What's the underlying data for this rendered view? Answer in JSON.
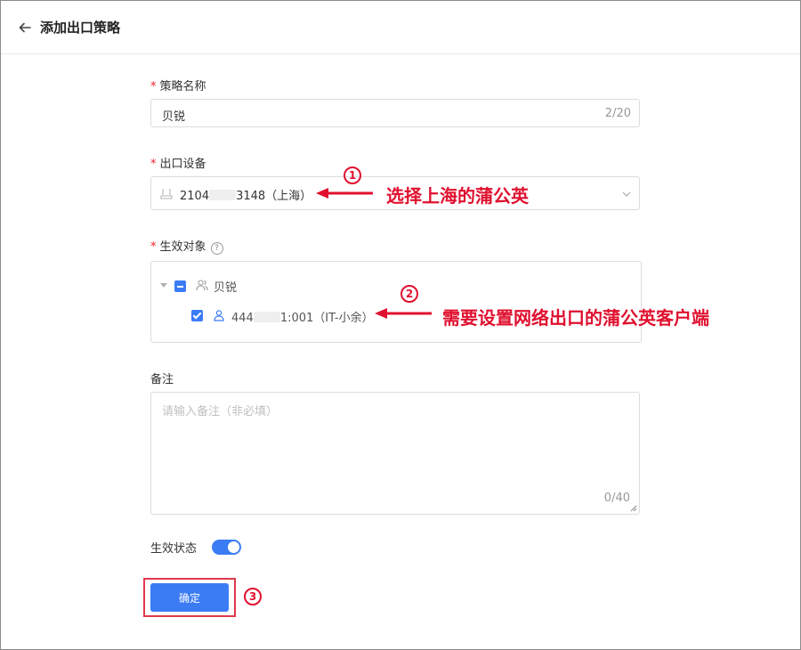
{
  "header": {
    "title": "添加出口策略"
  },
  "form": {
    "policy_name": {
      "label": "策略名称",
      "required_mark": "*",
      "value": "贝锐",
      "counter": "2/20"
    },
    "device": {
      "label": "出口设备",
      "required_mark": "*",
      "value_prefix": "2104",
      "value_suffix": "3148（上海）"
    },
    "targets": {
      "label": "生效对象",
      "required_mark": "*",
      "help": "?",
      "group": {
        "label": "贝锐"
      },
      "member": {
        "prefix": "444",
        "suffix": "1:001（IT-小余）"
      }
    },
    "remark": {
      "label": "备注",
      "placeholder": "请输入备注（非必填）",
      "counter": "0/40"
    },
    "status": {
      "label": "生效状态",
      "enabled": true
    },
    "confirm_label": "确定"
  },
  "annotations": {
    "step1": {
      "number": "1",
      "text": "选择上海的蒲公英"
    },
    "step2": {
      "number": "2",
      "text": "需要设置网络出口的蒲公英客户端"
    },
    "step3": {
      "number": "3"
    }
  },
  "colors": {
    "accent": "#3b7cf5",
    "annotation": "#e0102f",
    "required": "#f5222d"
  }
}
